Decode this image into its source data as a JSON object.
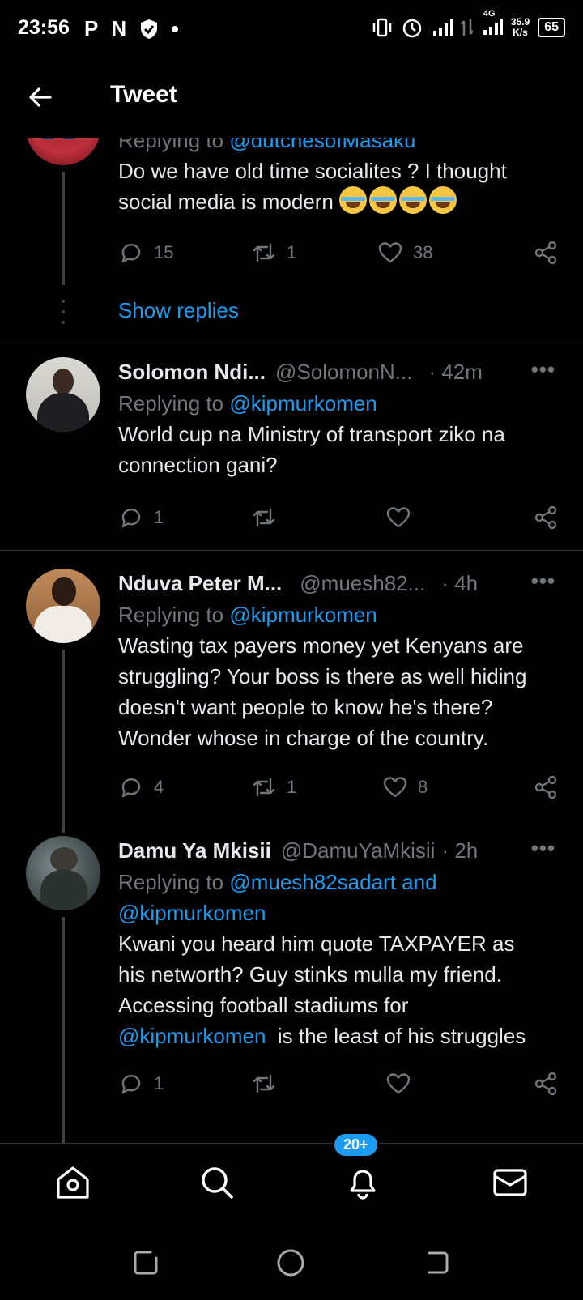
{
  "status_bar": {
    "time": "23:56",
    "left_icons": [
      "P",
      "N"
    ],
    "network": "4G",
    "speed_value": "35.9",
    "speed_unit": "K/s",
    "battery": "65"
  },
  "header": {
    "title": "Tweet"
  },
  "tweets": [
    {
      "reply_prefix": "Replying to ",
      "replying_to": "@dutchesofMasaku",
      "text": "Do we have old time socialites ? I thought social media is modern",
      "reply_count": "15",
      "retweet_count": "1",
      "like_count": "38"
    },
    {
      "name": "Solomon Ndi...",
      "handle": "@SolomonN...",
      "time": "· 42m",
      "reply_prefix": "Replying to ",
      "replying_to": "@kipmurkomen",
      "text": "World cup na Ministry of transport ziko na connection gani?",
      "reply_count": "1",
      "retweet_count": "",
      "like_count": ""
    },
    {
      "name": "Nduva Peter M...",
      "handle": "@muesh82...",
      "time": "· 4h",
      "reply_prefix": "Replying to ",
      "replying_to": "@kipmurkomen",
      "text": "Wasting tax payers money yet Kenyans are struggling? Your boss is there as well hiding doesn't want people to know he's there? Wonder whose in charge of the country.",
      "reply_count": "4",
      "retweet_count": "1",
      "like_count": "8"
    },
    {
      "name": "Damu Ya Mkisii",
      "handle": "@DamuYaMkisii",
      "time": "· 2h",
      "reply_prefix": "Replying to ",
      "replying_to": "@muesh82sadart and",
      "replying_to_2": "@kipmurkomen",
      "text_line1": "Kwani you heard him quote TAXPAYER as",
      "text_line2": "his networth? Guy stinks mulla my friend.",
      "text_line3": "Accessing football stadiums for",
      "text_mention": "@kipmurkomen",
      "text_tail": "is the least of his struggles",
      "reply_count": "1",
      "retweet_count": "",
      "like_count": ""
    }
  ],
  "show_replies": "Show replies",
  "more_label": "•••",
  "bottom_nav": {
    "notifications_badge": "20+"
  },
  "colors": {
    "accent": "#1d9bf0",
    "muted": "#71767b",
    "background": "#000000"
  }
}
